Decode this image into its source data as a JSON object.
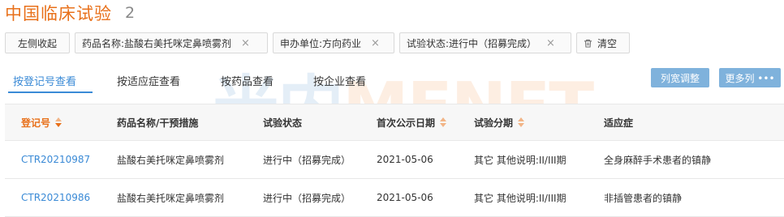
{
  "header": {
    "title": "中国临床试验",
    "count": "2"
  },
  "filters": {
    "collapse_label": "左侧收起",
    "chips": [
      "药品名称:盐酸右美托咪定鼻喷雾剂",
      "申办单位:方向药业",
      "试验状态:进行中（招募完成）"
    ],
    "close_glyph": "×",
    "clear_label": "清空"
  },
  "tabs": [
    "按登记号查看",
    "按适应症查看",
    "按药品查看",
    "按企业查看"
  ],
  "actions": {
    "col_width": "列宽调整",
    "more_cols": "更多列 •••"
  },
  "watermark": {
    "part_a": "米内",
    "part_b": "MENET"
  },
  "table": {
    "headers": [
      "登记号",
      "药品名称/干预措施",
      "试验状态",
      "首次公示日期",
      "试验分期",
      "适应症"
    ],
    "rows": [
      [
        "CTR20210987",
        "盐酸右美托咪定鼻喷雾剂",
        "进行中（招募完成）",
        "2021-05-06",
        "其它 其他说明:II/III期",
        "全身麻醉手术患者的镇静"
      ],
      [
        "CTR20210986",
        "盐酸右美托咪定鼻喷雾剂",
        "进行中（招募完成）",
        "2021-05-06",
        "其它 其他说明:II/III期",
        "非插管患者的镇静"
      ]
    ]
  },
  "colors": {
    "accent": "#e8701a",
    "link": "#3a8ad6",
    "button": "#7fb2dc"
  }
}
